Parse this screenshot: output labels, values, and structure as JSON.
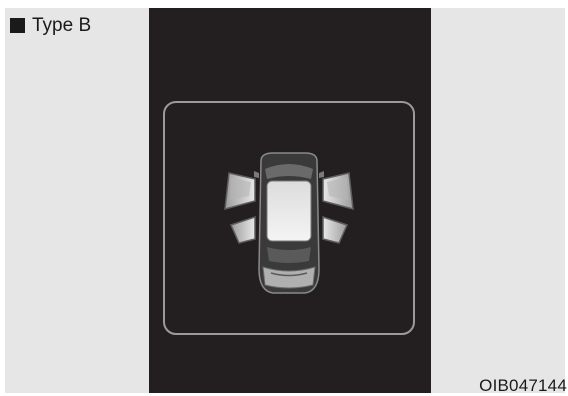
{
  "label": {
    "text": "Type B",
    "marker_icon": "black-square-icon"
  },
  "display": {
    "background": "#231f20",
    "frame_color": "#9a9a9a",
    "icon": "car-doors-open-icon",
    "open_doors": [
      "front-left",
      "front-right",
      "rear-left",
      "rear-right"
    ],
    "hood_open": false,
    "trunk_open": false
  },
  "figure_code": "OIB047144"
}
